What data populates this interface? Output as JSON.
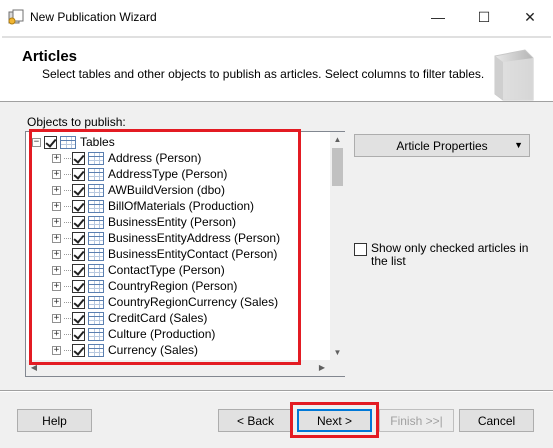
{
  "window": {
    "title": "New Publication Wizard",
    "minimize_glyph": "—",
    "maximize_glyph": "☐",
    "close_glyph": "✕"
  },
  "header": {
    "title": "Articles",
    "description": "Select tables and other objects to publish as articles. Select columns to filter tables."
  },
  "objects_label": "Objects to publish:",
  "tree": {
    "root": {
      "label": "Tables",
      "checked": true,
      "expander": "−"
    },
    "items": [
      {
        "label": "Address (Person)",
        "checked": true
      },
      {
        "label": "AddressType (Person)",
        "checked": true
      },
      {
        "label": "AWBuildVersion (dbo)",
        "checked": true
      },
      {
        "label": "BillOfMaterials (Production)",
        "checked": true
      },
      {
        "label": "BusinessEntity (Person)",
        "checked": true
      },
      {
        "label": "BusinessEntityAddress (Person)",
        "checked": true
      },
      {
        "label": "BusinessEntityContact (Person)",
        "checked": true
      },
      {
        "label": "ContactType (Person)",
        "checked": true
      },
      {
        "label": "CountryRegion (Person)",
        "checked": true
      },
      {
        "label": "CountryRegionCurrency (Sales)",
        "checked": true
      },
      {
        "label": "CreditCard (Sales)",
        "checked": true
      },
      {
        "label": "Culture (Production)",
        "checked": true
      },
      {
        "label": "Currency (Sales)",
        "checked": true
      }
    ],
    "child_expander": "+"
  },
  "article_properties_label": "Article Properties",
  "show_only_checked": {
    "label": "Show only checked articles in the list",
    "checked": false
  },
  "buttons": {
    "help": "Help",
    "back": "< Back",
    "next": "Next >",
    "finish": "Finish >>|",
    "cancel": "Cancel"
  },
  "colors": {
    "highlight": "#e31b23",
    "focus": "#0078d7"
  }
}
